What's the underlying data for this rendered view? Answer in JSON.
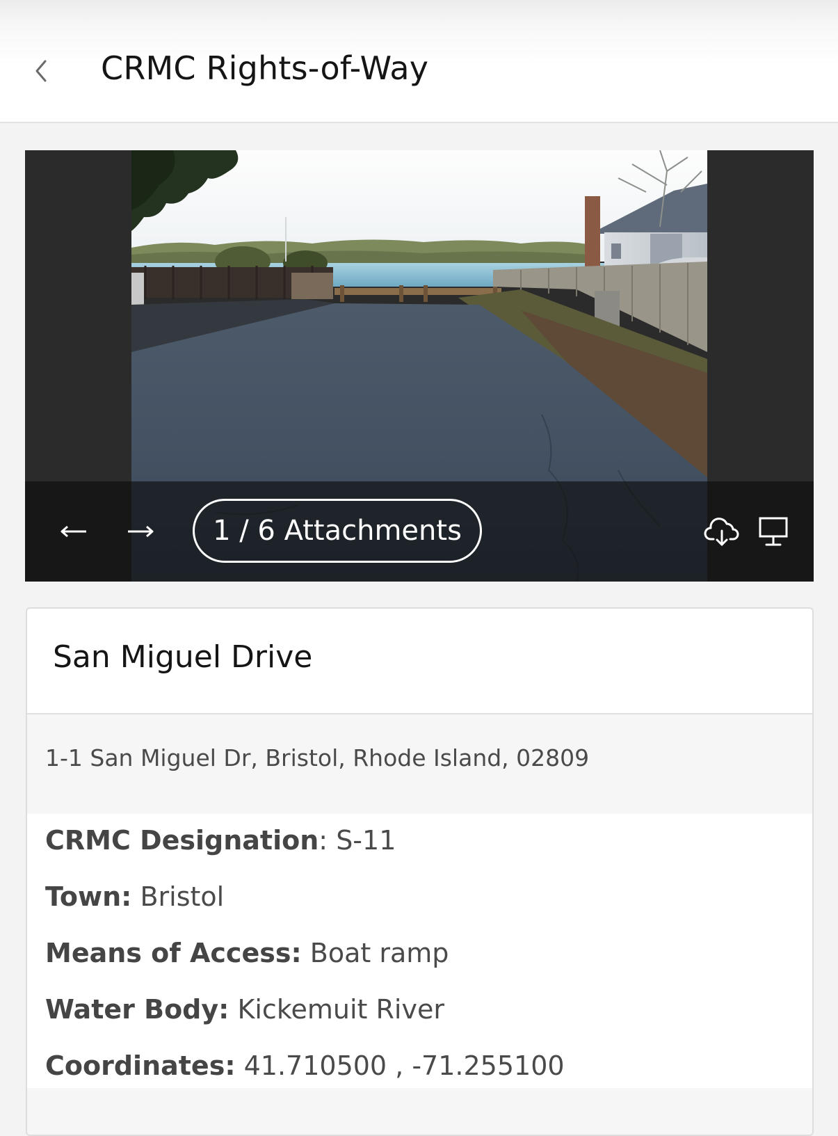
{
  "header": {
    "title": "CRMC Rights-of-Way",
    "back_icon": "chevron-left-icon"
  },
  "viewer": {
    "prev_icon": "arrow-left-icon",
    "next_icon": "arrow-right-icon",
    "attachments_label": "1 / 6 Attachments",
    "download_icon": "cloud-download-icon",
    "present_icon": "presentation-icon"
  },
  "record": {
    "title": "San Miguel Drive",
    "address": "1-1 San Miguel Dr, Bristol, Rhode Island, 02809",
    "fields": [
      {
        "label": "CRMC Designation",
        "separator": ": ",
        "value": "S-11"
      },
      {
        "label": "Town:",
        "separator": " ",
        "value": "Bristol"
      },
      {
        "label": "Means of Access:",
        "separator": " ",
        "value": "Boat ramp"
      },
      {
        "label": "Water Body:",
        "separator": " ",
        "value": "Kickemuit River"
      },
      {
        "label": "Coordinates:",
        "separator": " ",
        "value": "41.710500 , -71.255100"
      }
    ]
  },
  "colors": {
    "header_bg": "#ffffff",
    "viewer_bg": "#2b2b2b",
    "card_bg": "#ffffff",
    "address_band_bg": "#f6f6f6",
    "text_primary": "#151515",
    "text_secondary": "#4a4a4a"
  }
}
